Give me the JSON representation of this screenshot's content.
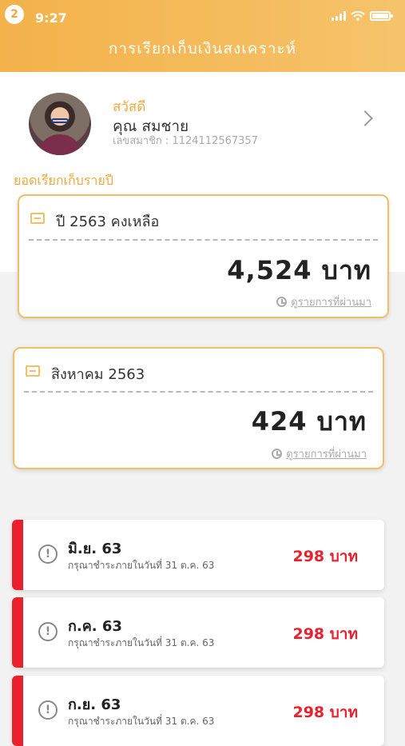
{
  "status": {
    "badge": "2",
    "time": "9:27"
  },
  "header": {
    "title": "การเรียกเก็บเงินสงเคราะห์"
  },
  "profile": {
    "greeting": "สวัสดี",
    "name": "คุณ สมชาย",
    "member_id": "เลขสมาชิก : 1124112567357"
  },
  "annual": {
    "section_title": "ยอดเรียกเก็บรายปี"
  },
  "cards": [
    {
      "label": "ปี 2563 คงเหลือ",
      "amount": "4,524 บาท",
      "history": "ดูรายการที่ผ่านมา"
    },
    {
      "label": "สิงหาคม 2563",
      "amount": "424 บาท",
      "history": "ดูรายการที่ผ่านมา"
    }
  ],
  "bills": [
    {
      "month": "มิ.ย. 63",
      "due": "กรุณาชำระภายในวันที่ 31 ต.ค. 63",
      "amount": "298 บาท"
    },
    {
      "month": "ก.ค. 63",
      "due": "กรุณาชำระภายในวันที่ 31 ต.ค. 63",
      "amount": "298 บาท"
    },
    {
      "month": "ก.ย. 63",
      "due": "กรุณาชำระภายในวันที่ 31 ต.ค. 63",
      "amount": "298 บาท"
    }
  ],
  "colors": {
    "brand": "#f3b24a",
    "alert": "#e9212c"
  }
}
